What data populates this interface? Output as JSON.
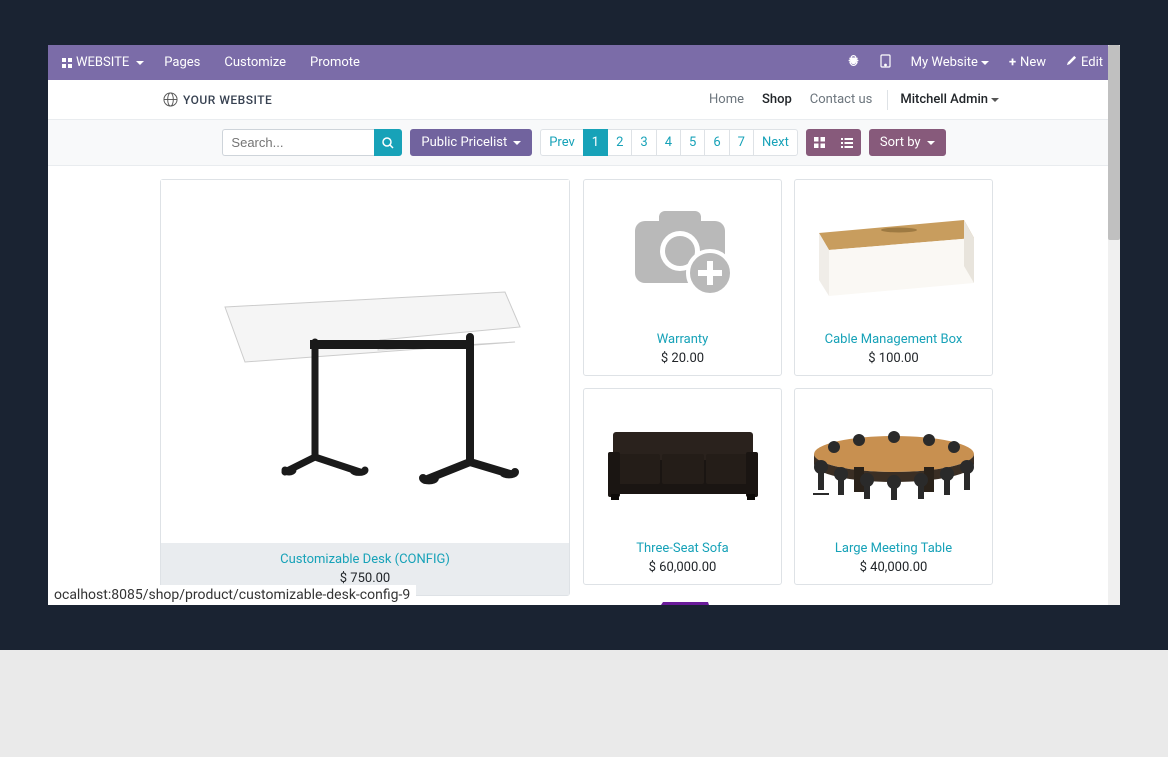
{
  "topbar": {
    "website_label": "WEBSITE",
    "pages": "Pages",
    "customize": "Customize",
    "promote": "Promote",
    "my_website": "My Website",
    "new": "New",
    "edit": "Edit"
  },
  "header": {
    "logo_text": "YOUR WEBSITE",
    "nav": {
      "home": "Home",
      "shop": "Shop",
      "contact": "Contact us"
    },
    "user": "Mitchell Admin"
  },
  "toolbar": {
    "search_placeholder": "Search...",
    "pricelist": "Public Pricelist",
    "pagination": {
      "prev": "Prev",
      "next": "Next",
      "pages": [
        "1",
        "2",
        "3",
        "4",
        "5",
        "6",
        "7"
      ],
      "active": "1"
    },
    "sort": "Sort by"
  },
  "products": {
    "featured": {
      "name": "Customizable Desk (CONFIG)",
      "price": "$ 750.00"
    },
    "items": [
      {
        "name": "Warranty",
        "price": "$ 20.00"
      },
      {
        "name": "Cable Management Box",
        "price": "$ 100.00"
      },
      {
        "name": "Three-Seat Sofa",
        "price": "$ 60,000.00"
      },
      {
        "name": "Large Meeting Table",
        "price": "$ 40,000.00"
      }
    ]
  },
  "status_url": "ocalhost:8085/shop/product/customizable-desk-config-9"
}
